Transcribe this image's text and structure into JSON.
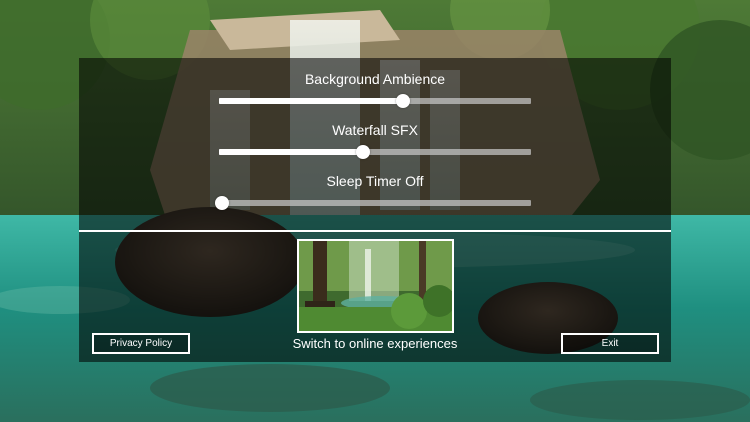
{
  "sliders": [
    {
      "label": "Background Ambience",
      "value": 0.59
    },
    {
      "label": "Waterfall SFX",
      "value": 0.46
    },
    {
      "label": "Sleep Timer Off",
      "value": 0.01
    }
  ],
  "online": {
    "label": "Switch to online experiences"
  },
  "buttons": {
    "privacy_label": "Privacy Policy",
    "exit_label": "Exit"
  },
  "colors": {
    "water": "#1f8f80",
    "forest": "#2a4a26",
    "panel_overlay": "#000000"
  }
}
